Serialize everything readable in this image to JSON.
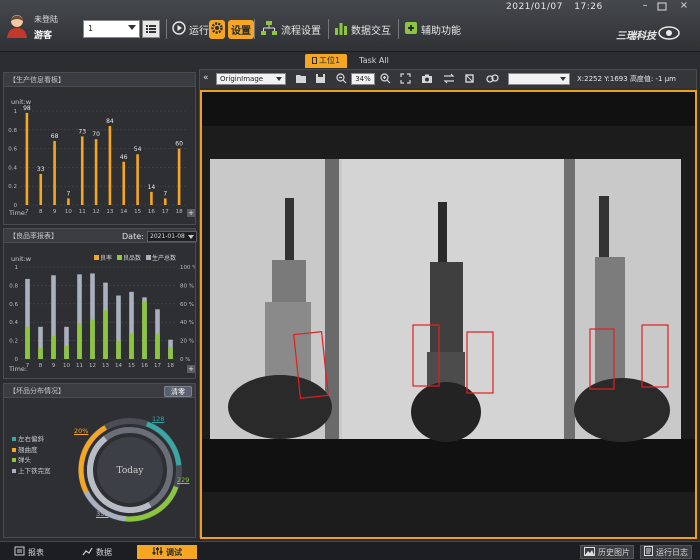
{
  "header": {
    "user_login_label": "未登陆",
    "user_name": "游客",
    "station_select_value": "1",
    "date": "2021/01/07",
    "time": "17:26",
    "brand": "三瑞科技",
    "run_label": "运行",
    "settings_label": "设置",
    "flow_label": "流程设置",
    "data_label": "数据交互",
    "aux_label": "辅助功能"
  },
  "tabs": [
    "工位1",
    "Task All"
  ],
  "production_panel": {
    "title": "【生产信息看板】",
    "unit": "unit:w",
    "time_label": "Time:",
    "chart_data": {
      "type": "bar",
      "categories": [
        "7",
        "8",
        "9",
        "10",
        "11",
        "12",
        "13",
        "14",
        "15",
        "16",
        "17",
        "18"
      ],
      "values": [
        98,
        33,
        68,
        7,
        73,
        70,
        84,
        46,
        54,
        14,
        7,
        60
      ],
      "ylim": [
        0,
        1
      ],
      "yticks": [
        "0",
        "0.2",
        "0.4",
        "0.6",
        "0.8",
        "1"
      ]
    }
  },
  "yield_panel": {
    "title": "【良品率报表】",
    "date_label": "Date:",
    "date_value": "2021-01-08",
    "unit": "unit:w",
    "time_label": "Time:",
    "legend": [
      "良率",
      "良品数",
      "生产总数"
    ],
    "chart_data": {
      "type": "bar",
      "categories": [
        "7",
        "8",
        "9",
        "10",
        "11",
        "12",
        "13",
        "14",
        "15",
        "16",
        "17",
        "18"
      ],
      "series": [
        {
          "name": "生产总数",
          "values": [
            0.87,
            0.35,
            0.91,
            0.35,
            0.92,
            0.93,
            0.83,
            0.69,
            0.73,
            0.67,
            0.54,
            0.21
          ]
        },
        {
          "name": "良品数",
          "values": [
            0.35,
            0.12,
            0.25,
            0.15,
            0.39,
            0.43,
            0.53,
            0.2,
            0.28,
            0.63,
            0.27,
            0.13
          ]
        }
      ],
      "ylim": [
        0,
        1
      ],
      "yticks": [
        "0",
        "0.2",
        "0.4",
        "0.6",
        "0.8",
        "1"
      ],
      "y2ticks": [
        "0 %",
        "20 %",
        "40 %",
        "60 %",
        "80 %",
        "100 %"
      ]
    }
  },
  "defect_panel": {
    "title": "【坏品分布情况】",
    "clear_label": "清零",
    "legend": [
      "左右偏斜",
      "翘曲度",
      "弹头",
      "上下铁完宽"
    ],
    "center_label": "Today",
    "labels": [
      "128",
      "20%",
      "229",
      "353"
    ]
  },
  "viewer": {
    "image_select_value": "OriginImage",
    "zoom_value": "34%",
    "coords_text": "X:2252 Y:1693 高度值: -1 μm"
  },
  "bottom": {
    "report_label": "报表",
    "data_label": "数据",
    "debug_label": "调试",
    "history_label": "历史图片",
    "log_label": "运行日志"
  },
  "colors": {
    "accent": "#f5a623",
    "green": "#8cc63f",
    "bar_gray": "#aab0bd",
    "teal": "#3aa6a6",
    "roi_red": "#e02020"
  }
}
